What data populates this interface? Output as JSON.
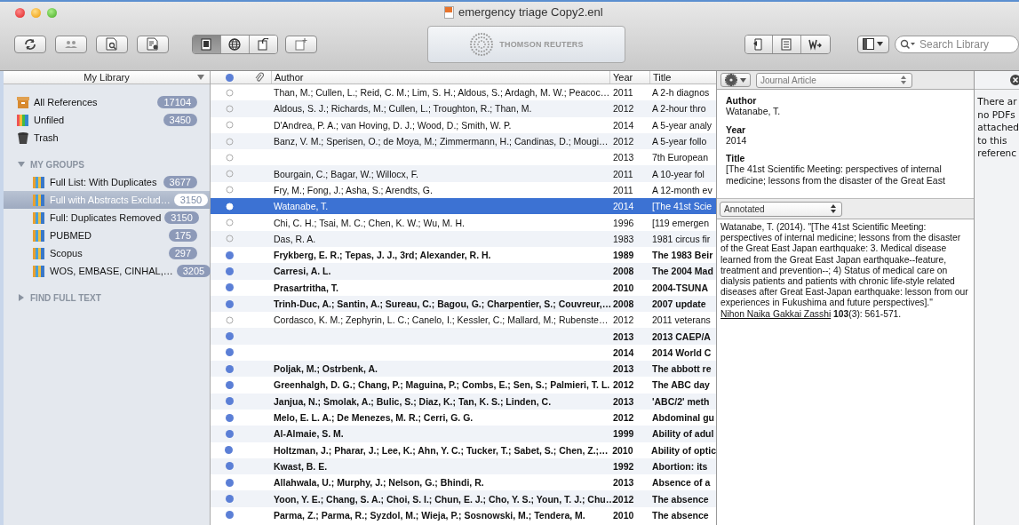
{
  "window": {
    "title": "emergency triage Copy2.enl"
  },
  "toolbar": {
    "logo": "THOMSON REUTERS",
    "search": {
      "placeholder": "Search Library"
    },
    "layout_modes": [
      {
        "selected": true
      },
      {
        "selected": false
      },
      {
        "selected": false
      }
    ]
  },
  "sidebar": {
    "header": "My Library",
    "library": [
      {
        "label": "All References",
        "count": "17104",
        "kind": "all"
      },
      {
        "label": "Unfiled",
        "count": "3450",
        "kind": "group"
      },
      {
        "label": "Trash",
        "kind": "trash"
      }
    ],
    "sections": [
      {
        "label": "MY GROUPS",
        "expanded": true,
        "items": [
          {
            "label": "Full List: With Duplicates",
            "count": "3677",
            "selected": false
          },
          {
            "label": "Full with Abstracts Exclud…",
            "count": "3150",
            "selected": true
          },
          {
            "label": "Full: Duplicates Removed",
            "count": "3150",
            "selected": false
          },
          {
            "label": "PUBMED",
            "count": "175",
            "selected": false
          },
          {
            "label": "Scopus",
            "count": "297",
            "selected": false
          },
          {
            "label": "WOS, EMBASE, CINHAL,…",
            "count": "3205",
            "selected": false
          }
        ]
      },
      {
        "label": "FIND FULL TEXT",
        "expanded": false
      }
    ]
  },
  "table": {
    "columns": [
      "Author",
      "Year",
      "Title"
    ],
    "rows": [
      {
        "author": "Than, M.; Cullen, L.; Reid, C. M.; Lim, S. H.; Aldous, S.; Ardagh, M. W.; Peacoc…",
        "year": "2011",
        "title": "A 2-h diagnos",
        "read": true,
        "selected": false
      },
      {
        "author": "Aldous, S. J.; Richards, M.; Cullen, L.; Troughton, R.; Than, M.",
        "year": "2012",
        "title": "A 2-hour thro",
        "read": true,
        "selected": false
      },
      {
        "author": "D'Andrea, P. A.; van Hoving, D. J.; Wood, D.; Smith, W. P.",
        "year": "2014",
        "title": "A 5-year analy",
        "read": true,
        "selected": false
      },
      {
        "author": "Banz, V. M.; Sperisen, O.; de Moya, M.; Zimmermann, H.; Candinas, D.; Mougi…",
        "year": "2012",
        "title": "A 5-year follo",
        "read": true,
        "selected": false
      },
      {
        "author": "",
        "year": "2013",
        "title": "7th European",
        "read": true,
        "selected": false
      },
      {
        "author": "Bourgain, C.; Bagar, W.; Willocx, F.",
        "year": "2011",
        "title": "A 10-year fol",
        "read": true,
        "selected": false
      },
      {
        "author": "Fry, M.; Fong, J.; Asha, S.; Arendts, G.",
        "year": "2011",
        "title": "A 12-month ev",
        "read": true,
        "selected": false
      },
      {
        "author": "Watanabe, T.",
        "year": "2014",
        "title": "[The 41st Scie",
        "read": true,
        "selected": true
      },
      {
        "author": "Chi, C. H.; Tsai, M. C.; Chen, K. W.; Wu, M. H.",
        "year": "1996",
        "title": "[119 emergen",
        "read": true,
        "selected": false
      },
      {
        "author": "Das, R. A.",
        "year": "1983",
        "title": "1981 circus fir",
        "read": true,
        "selected": false
      },
      {
        "author": "Frykberg, E. R.; Tepas, J. J., 3rd; Alexander, R. H.",
        "year": "1989",
        "title": "The 1983 Beir",
        "read": false,
        "selected": false
      },
      {
        "author": "Carresi, A. L.",
        "year": "2008",
        "title": "The 2004 Mad",
        "read": false,
        "selected": false
      },
      {
        "author": "Prasartritha, T.",
        "year": "2010",
        "title": "2004-TSUNA",
        "read": false,
        "selected": false
      },
      {
        "author": "Trinh-Duc, A.; Santin, A.; Sureau, C.; Bagou, G.; Charpentier, S.; Couvreur,…",
        "year": "2008",
        "title": "2007 update",
        "read": false,
        "selected": false
      },
      {
        "author": "Cordasco, K. M.; Zephyrin, L. C.; Canelo, I.; Kessler, C.; Mallard, M.; Rubenste…",
        "year": "2012",
        "title": "2011 veterans",
        "read": true,
        "selected": false
      },
      {
        "author": "",
        "year": "2013",
        "title": "2013 CAEP/A",
        "read": false,
        "selected": false
      },
      {
        "author": "",
        "year": "2014",
        "title": "2014 World C",
        "read": false,
        "selected": false
      },
      {
        "author": "Poljak, M.; Ostrbenk, A.",
        "year": "2013",
        "title": "The abbott re",
        "read": false,
        "selected": false
      },
      {
        "author": "Greenhalgh, D. G.; Chang, P.; Maguina, P.; Combs, E.; Sen, S.; Palmieri, T. L.",
        "year": "2012",
        "title": "The ABC day",
        "read": false,
        "selected": false
      },
      {
        "author": "Janjua, N.; Smolak, A.; Bulic, S.; Diaz, K.; Tan, K. S.; Linden, C.",
        "year": "2013",
        "title": "'ABC/2' meth",
        "read": false,
        "selected": false
      },
      {
        "author": "Melo, E. L. A.; De Menezes, M. R.; Cerri, G. G.",
        "year": "2012",
        "title": "Abdominal gu",
        "read": false,
        "selected": false
      },
      {
        "author": "Al-Almaie, S. M.",
        "year": "1999",
        "title": "Ability of adul",
        "read": false,
        "selected": false
      },
      {
        "author": "Holtzman, J.; Pharar, J.; Lee, K.; Ahn, Y. C.; Tucker, T.; Sabet, S.; Chen, Z.;…",
        "year": "2010",
        "title": "Ability of optic",
        "read": false,
        "selected": false
      },
      {
        "author": "Kwast, B. E.",
        "year": "1992",
        "title": "Abortion: its",
        "read": false,
        "selected": false
      },
      {
        "author": "Allahwala, U.; Murphy, J.; Nelson, G.; Bhindi, R.",
        "year": "2013",
        "title": "Absence of a",
        "read": false,
        "selected": false
      },
      {
        "author": "Yoon, Y. E.; Chang, S. A.; Choi, S. I.; Chun, E. J.; Cho, Y. S.; Youn, T. J.; Chu…",
        "year": "2012",
        "title": "The absence",
        "read": false,
        "selected": false
      },
      {
        "author": "Parma, Z.; Parma, R.; Syzdol, M.; Wieja, P.; Sosnowski, M.; Tendera, M.",
        "year": "2010",
        "title": "The absence",
        "read": false,
        "selected": false
      }
    ]
  },
  "reference": {
    "type": "Journal Article",
    "fields": [
      {
        "label": "Author",
        "value": "Watanabe, T."
      },
      {
        "label": "Year",
        "value": "2014"
      },
      {
        "label": "Title",
        "value": "[The 41st Scientific Meeting: perspectives of internal medicine; lessons from the disaster of the Great East"
      }
    ],
    "style": "Annotated",
    "citation": {
      "before": "Watanabe, T. (2014). \"[The 41st Scientific Meeting: perspectives of internal medicine; lessons from the disaster of the Great East Japan earthquake: 3. Medical disease learned from the Great East Japan earthquake--feature, treatment and prevention--; 4) Status of medical care on dialysis patients and patients with chronic life-style related diseases after Great East-Japan earthquake: lesson from our experiences in Fukushima and future perspectives].\"",
      "journal": "Nihon Naika Gakkai Zasshi",
      "after": "**103**(3): 561-571."
    }
  },
  "pdf_panel": {
    "lines": [
      "There ar",
      "no PDFs",
      "attached",
      "to this",
      "referenc"
    ]
  }
}
